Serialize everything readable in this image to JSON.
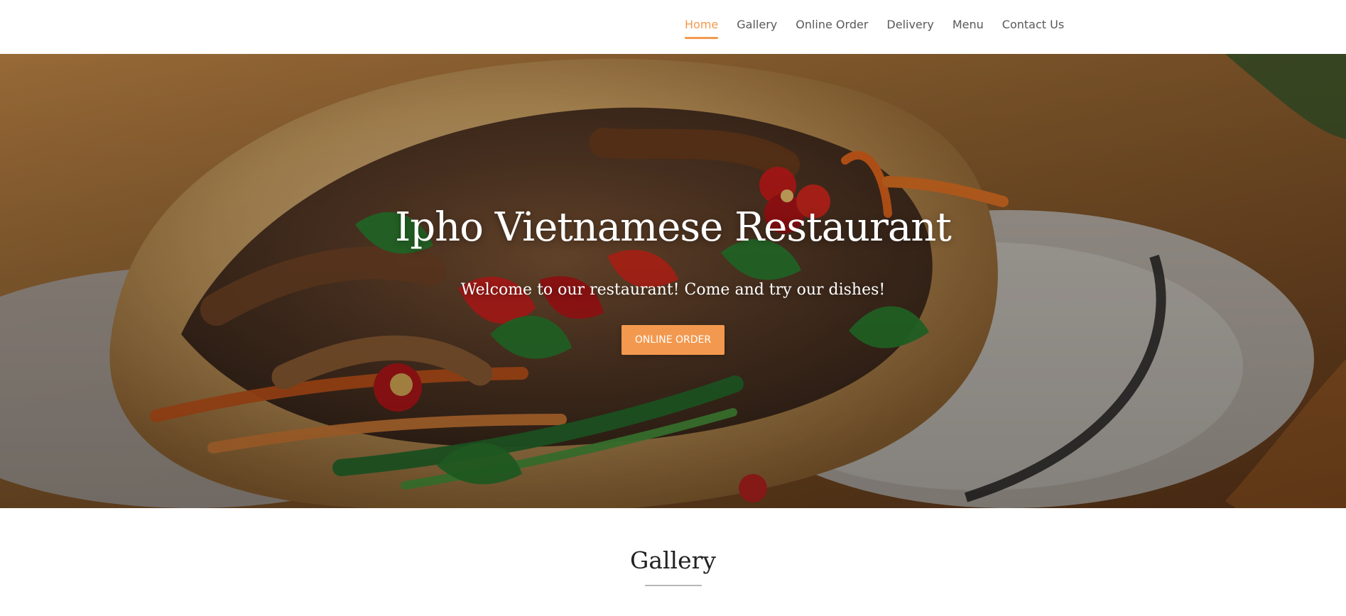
{
  "nav": {
    "items": [
      {
        "label": "Home",
        "active": true
      },
      {
        "label": "Gallery",
        "active": false
      },
      {
        "label": "Online Order",
        "active": false
      },
      {
        "label": "Delivery",
        "active": false
      },
      {
        "label": "Menu",
        "active": false
      },
      {
        "label": "Contact Us",
        "active": false
      }
    ],
    "active_color": "#f3994f",
    "text_color": "#595959"
  },
  "hero": {
    "title": "Ipho Vietnamese Restaurant",
    "subtitle": "Welcome to our restaurant! Come and try our dishes!",
    "cta_label": "ONLINE ORDER",
    "button_color": "#f3994f"
  },
  "gallery": {
    "title": "Gallery",
    "divider_color": "#b7b7b7"
  }
}
